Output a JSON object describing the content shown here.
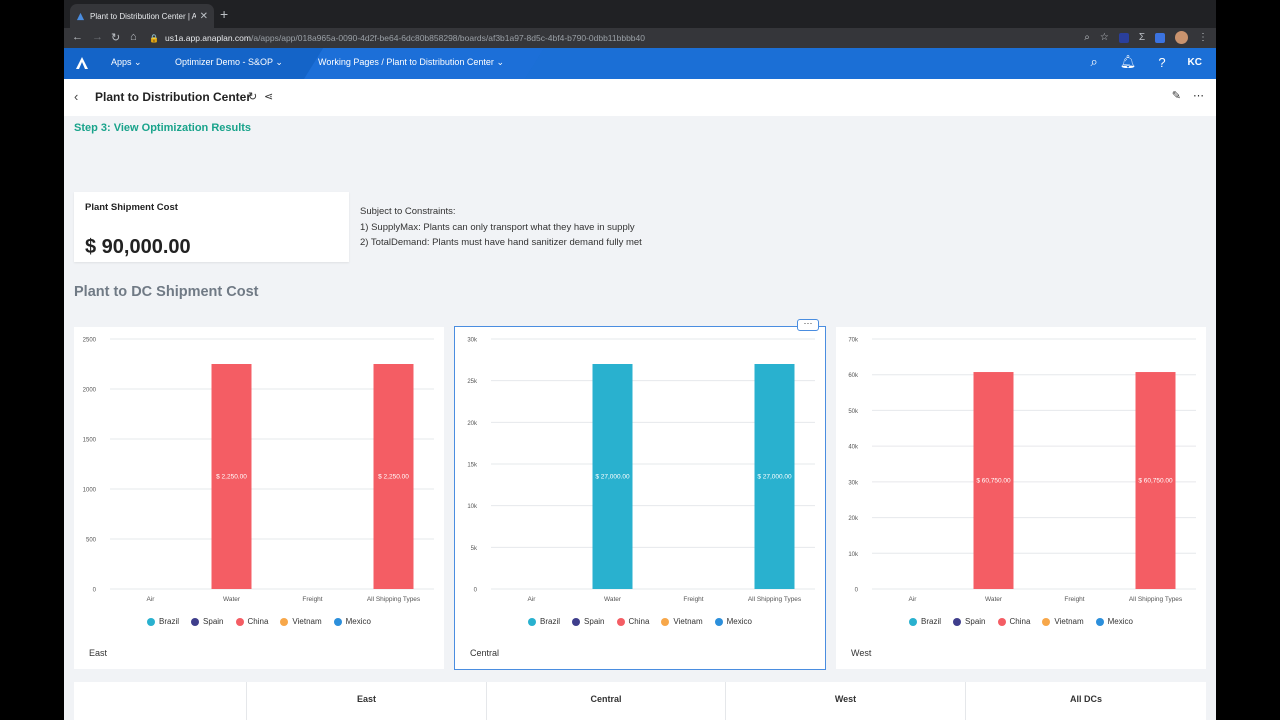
{
  "browser": {
    "tab_title": "Plant to Distribution Center | A",
    "url_host": "us1a.app.anaplan.com",
    "url_path": "/a/apps/app/018a965a-0090-4d2f-be64-6dc80b858298/boards/af3b1a97-8d5c-4bf4-b790-0dbb11bbbb40"
  },
  "header": {
    "apps_label": "Apps",
    "workspace_label": "Optimizer Demo - S&OP",
    "breadcrumb_label": "Working Pages / Plant to Distribution Center",
    "user_initials": "KC"
  },
  "page": {
    "title": "Plant to Distribution Center",
    "step_title": "Step 3: View Optimization Results",
    "section_title": "Plant to DC Shipment Cost"
  },
  "cost_card": {
    "label": "Plant Shipment Cost",
    "value": "$ 90,000.00"
  },
  "constraints": [
    "Subject to Constraints:",
    "1) SupplyMax: Plants can only transport what they have in supply",
    "2) TotalDemand: Plants must have hand sanitizer demand fully met"
  ],
  "legend": [
    {
      "name": "Brazil",
      "color": "#29b1cf"
    },
    {
      "name": "Spain",
      "color": "#3f3e8c"
    },
    {
      "name": "China",
      "color": "#f45d64"
    },
    {
      "name": "Vietnam",
      "color": "#f7a74a"
    },
    {
      "name": "Mexico",
      "color": "#2c8fdb"
    }
  ],
  "chart_data": [
    {
      "type": "bar",
      "card_label": "East",
      "categories": [
        "Air",
        "Water",
        "Freight",
        "All Shipping Types"
      ],
      "values": [
        0,
        2250,
        0,
        2250
      ],
      "bar_labels": [
        "",
        "$ 2,250.00",
        "",
        "$ 2,250.00"
      ],
      "bar_color": "#f45d64",
      "ylim": [
        0,
        2500
      ],
      "yticks": [
        0,
        500,
        1000,
        1500,
        2000,
        2500
      ],
      "ytick_labels": [
        "0",
        "500",
        "1000",
        "1500",
        "2000",
        "2500"
      ]
    },
    {
      "type": "bar",
      "card_label": "Central",
      "categories": [
        "Air",
        "Water",
        "Freight",
        "All Shipping Types"
      ],
      "values": [
        0,
        27000,
        0,
        27000
      ],
      "bar_labels": [
        "",
        "$ 27,000.00",
        "",
        "$ 27,000.00"
      ],
      "bar_color": "#29b1cf",
      "ylim": [
        0,
        30000
      ],
      "yticks": [
        0,
        5000,
        10000,
        15000,
        20000,
        25000,
        30000
      ],
      "ytick_labels": [
        "0",
        "5k",
        "10k",
        "15k",
        "20k",
        "25k",
        "30k"
      ]
    },
    {
      "type": "bar",
      "card_label": "West",
      "categories": [
        "Air",
        "Water",
        "Freight",
        "All Shipping Types"
      ],
      "values": [
        0,
        60750,
        0,
        60750
      ],
      "bar_labels": [
        "",
        "$ 60,750.00",
        "",
        "$ 60,750.00"
      ],
      "bar_color": "#f45d64",
      "ylim": [
        0,
        70000
      ],
      "yticks": [
        0,
        10000,
        20000,
        30000,
        40000,
        50000,
        60000,
        70000
      ],
      "ytick_labels": [
        "0",
        "10k",
        "20k",
        "30k",
        "40k",
        "50k",
        "60k",
        "70k"
      ]
    }
  ],
  "table": {
    "columns": [
      "East",
      "Central",
      "West",
      "All DCs"
    ]
  }
}
